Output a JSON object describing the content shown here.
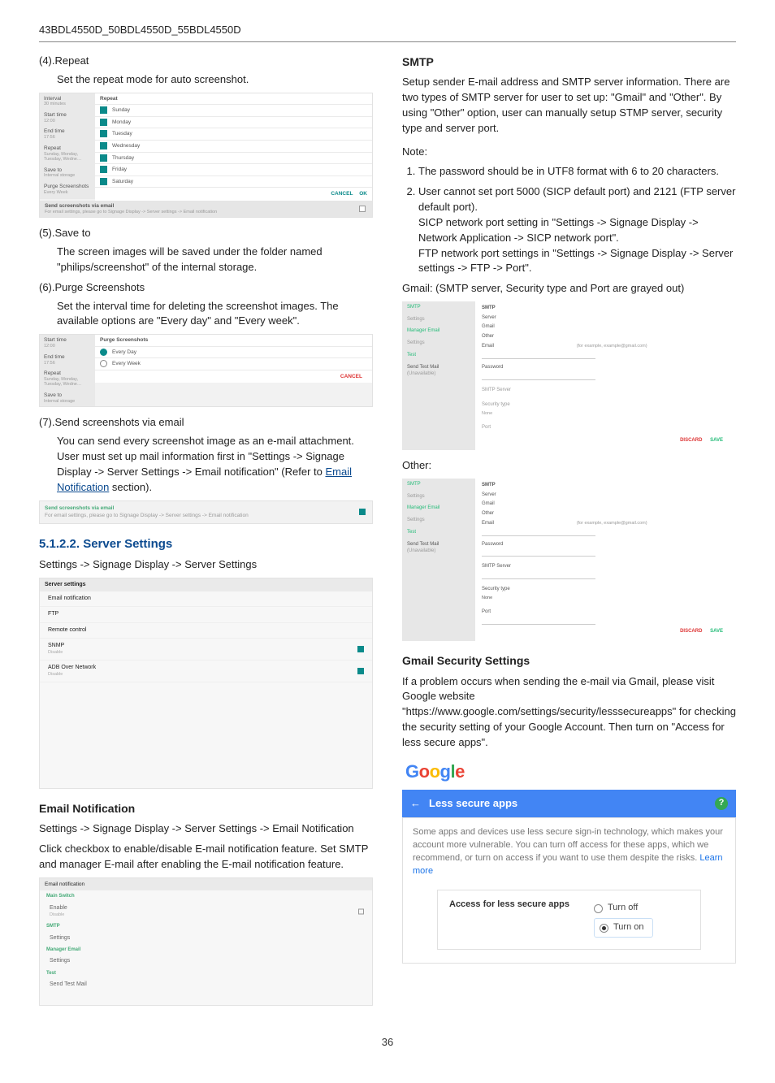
{
  "header": {
    "model": "43BDL4550D_50BDL4550D_55BDL4550D"
  },
  "page_number": "36",
  "left": {
    "items": {
      "repeat": {
        "num": "(4).",
        "title": "Repeat",
        "desc": "Set the repeat mode for auto screenshot."
      },
      "save_to": {
        "num": "(5).",
        "title": "Save to",
        "desc": "The screen images will be saved under the folder named \"philips/screenshot\" of the internal storage."
      },
      "purge": {
        "num": "(6).",
        "title": "Purge Screenshots",
        "desc": "Set the interval time for deleting the screenshot images. The available options are \"Every day\" and \"Every week\"."
      },
      "send": {
        "num": "(7).",
        "title": "Send screenshots via email",
        "desc_a": "You can send every screenshot image as an e-mail attachment. User must set up mail information first in \"Settings -> Signage Display -> Server Settings -> Email notification\" (Refer to ",
        "link": "Email Notification",
        "desc_b": " section)."
      }
    },
    "repeat_panel": {
      "side": {
        "interval": {
          "t": "Interval",
          "s": "30 minutes"
        },
        "start": {
          "t": "Start time",
          "s": "12:00"
        },
        "end": {
          "t": "End time",
          "s": "17:56"
        },
        "repeat": {
          "t": "Repeat",
          "s": "Sunday, Monday, Tuesday, Wedne…"
        },
        "saveto": {
          "t": "Save to",
          "s": "Internal storage"
        },
        "purge": {
          "t": "Purge Screenshots",
          "s": "Every Week"
        }
      },
      "title": "Repeat",
      "days": [
        "Sunday",
        "Monday",
        "Tuesday",
        "Wednesday",
        "Thursday",
        "Friday",
        "Saturday"
      ],
      "cancel": "CANCEL",
      "ok": "OK",
      "footer_t": "Send screenshots via email",
      "footer_s": "For email settings, please go to Signage Display -> Server settings -> Email notification"
    },
    "purge_panel": {
      "side": {
        "start": {
          "t": "Start time",
          "s": "12:00"
        },
        "end": {
          "t": "End time",
          "s": "17:56"
        },
        "repeat": {
          "t": "Repeat",
          "s": "Sunday, Monday, Tuesday, Wedne…"
        },
        "saveto": {
          "t": "Save to",
          "s": "Internal storage"
        }
      },
      "title": "Purge Screenshots",
      "opt1": "Every Day",
      "opt2": "Every Week",
      "cancel": "CANCEL"
    },
    "send_panel": {
      "t": "Send screenshots via email",
      "s": "For email settings, please go to Signage Display -> Server settings -> Email notification"
    },
    "server_settings": {
      "heading": "5.1.2.2. Server Settings",
      "path": "Settings -> Signage Display -> Server Settings",
      "panel": {
        "hdr": "Server settings",
        "items": {
          "email": "Email notification",
          "ftp": "FTP",
          "remote": "Remote control",
          "snmp": {
            "t": "SNMP",
            "s": "Disable"
          },
          "adb": {
            "t": "ADB Over Network",
            "s": "Disable"
          }
        }
      }
    },
    "email_notification": {
      "heading": "Email Notification",
      "path": "Settings -> Signage Display -> Server Settings -> Email Notification",
      "para": "Click checkbox to enable/disable E-mail notification feature. Set SMTP and manager E-mail after enabling the E-mail notification feature.",
      "panel": {
        "hdr": "Email notification",
        "groups": {
          "main": {
            "label": "Main Switch",
            "item": "Enable",
            "sub": "Disable"
          },
          "smtp": {
            "label": "SMTP",
            "item": "Settings"
          },
          "manager": {
            "label": "Manager Email",
            "item": "Settings"
          },
          "test": {
            "label": "Test",
            "item": "Send Test Mail"
          }
        }
      }
    }
  },
  "right": {
    "smtp": {
      "heading": "SMTP",
      "p1": "Setup sender E-mail address and SMTP server information. There are two types of SMTP server for user to set up: \"Gmail\" and \"Other\". By using \"Other\" option, user can manually setup STMP server, security type and server port.",
      "note_label": "Note:",
      "notes": {
        "n1": "The password should be in UTF8 format with 6 to 20 characters.",
        "n2a": "User cannot set port 5000 (SICP default port) and 2121 (FTP server default port).",
        "n2b": "SICP network port setting in \"Settings -> Signage Display -> Network Application -> SICP network port\".",
        "n2c": "FTP network port settings in \"Settings -> Signage Display -> Server settings -> FTP -> Port\"."
      },
      "gmail_label": "Gmail: (SMTP server, Security type and Port are grayed out)",
      "other_label": "Other:",
      "panel_common": {
        "side": {
          "smtp": "SMTP",
          "settings": "Settings",
          "manager": "Manager Email",
          "settings2": "Settings",
          "test": "Test",
          "sendtest": "Send Test Mail",
          "shadow": "(Unavailable)"
        },
        "title": "SMTP",
        "server_lbl": "Server",
        "gmail": "Gmail",
        "other": "Other",
        "email": "Email",
        "hint": "(for example, example@gmail.com)",
        "password": "Password",
        "smtpserver": "SMTP Server",
        "security": "Security type",
        "secval": "None",
        "port": "Port",
        "discard": "DISCARD",
        "save": "SAVE"
      }
    },
    "gmail_sec": {
      "heading": "Gmail Security Settings",
      "para": "If a problem occurs when sending the e-mail via Gmail, please visit Google website \"https://www.google.com/settings/security/lesssecureapps\" for checking the security setting of your Google Account. Then turn on \"Access for less secure apps\".",
      "google": [
        "G",
        "o",
        "o",
        "g",
        "l",
        "e"
      ],
      "bar": "Less secure apps",
      "body_a": "Some apps and devices use less secure sign-in technology, which makes your account more vulnerable. You can turn off access for these apps, which we recommend, or turn on access if you want to use them despite the risks. ",
      "body_link": "Learn more",
      "access_label": "Access for less secure apps",
      "turn_off": "Turn off",
      "turn_on": "Turn on"
    }
  }
}
